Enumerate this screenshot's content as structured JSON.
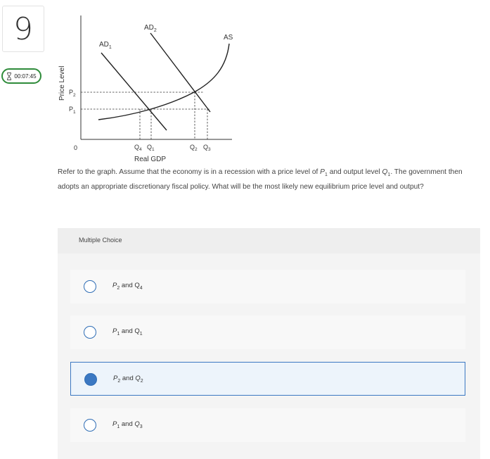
{
  "question_number": "9",
  "timer": {
    "time": "00:07:45"
  },
  "graph": {
    "y_axis_label": "Price Level",
    "x_axis_label": "Real GDP",
    "origin_label": "0",
    "ad1_label": "AD",
    "ad1_sub": "1",
    "ad2_label": "AD",
    "ad2_sub": "2",
    "as_label": "AS",
    "p2_label": "P",
    "p2_sub": "2",
    "p1_label": "P",
    "p1_sub": "1",
    "q4_label": "Q",
    "q4_sub": "4",
    "q1_label": "Q",
    "q1_sub": "1",
    "q2_label": "Q",
    "q2_sub": "2",
    "q3_label": "Q",
    "q3_sub": "3"
  },
  "question": {
    "text_1": "Refer to the graph. Assume that the economy is in a recession with a price level of ",
    "p": "P",
    "p_sub": "1",
    "text_2": " and output level ",
    "q": "Q",
    "q_sub": "1",
    "text_3": ". The government then adopts an appropriate discretionary fiscal policy. What will be the most likely new equilibrium price level and output?"
  },
  "multiple_choice": {
    "header": "Multiple Choice",
    "options": [
      {
        "p": "P",
        "p_sub": "2",
        "and": " and ",
        "q": "Q",
        "q_sub": "4",
        "selected": false
      },
      {
        "p": "P",
        "p_sub": "1",
        "and": " and ",
        "q": "Q",
        "q_sub": "1",
        "selected": false
      },
      {
        "p": "P",
        "p_sub": "2",
        "and": " and ",
        "q": "Q",
        "q_sub": "2",
        "selected": true
      },
      {
        "p": "P",
        "p_sub": "1",
        "and": " and ",
        "q": "Q",
        "q_sub": "3",
        "selected": false
      }
    ]
  },
  "colors": {
    "accent": "#3b78c2",
    "timer_border": "#2e8b3a",
    "selected_bg": "#edf4fb"
  }
}
